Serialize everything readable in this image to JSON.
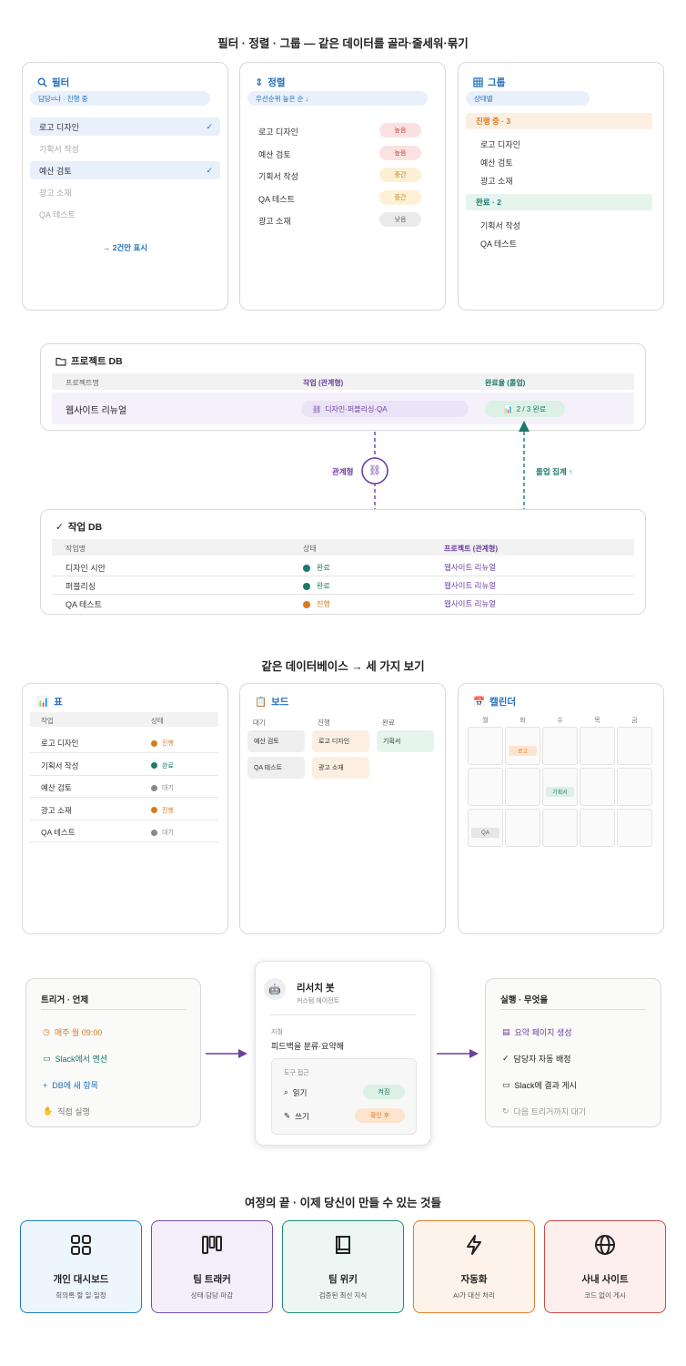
{
  "section1": {
    "title": "필터 · 정렬 · 그룹 — 같은 데이터를 골라·줄세워·묶기",
    "filter": {
      "title": "필터",
      "condition": "담당=나 · 진행 중",
      "items": [
        {
          "label": "로고 디자인",
          "matched": true
        },
        {
          "label": "기획서 작성",
          "matched": false
        },
        {
          "label": "예산 검토",
          "matched": true
        },
        {
          "label": "광고 소재",
          "matched": false
        },
        {
          "label": "QA 테스트",
          "matched": false
        }
      ],
      "check": "✓",
      "result": "→ 2건만 표시"
    },
    "sort": {
      "title": "정렬",
      "condition": "우선순위 높은 순 ↓",
      "items": [
        {
          "label": "로고 디자인",
          "priority": "높음"
        },
        {
          "label": "예산 검토",
          "priority": "높음"
        },
        {
          "label": "기획서 작성",
          "priority": "중간"
        },
        {
          "label": "QA 테스트",
          "priority": "중간"
        },
        {
          "label": "광고 소재",
          "priority": "낮음"
        }
      ]
    },
    "group": {
      "title": "그룹",
      "condition": "상태별",
      "groups": [
        {
          "header": "진행 중 · 3",
          "items": [
            "로고 디자인",
            "예산 검토",
            "광고 소재"
          ]
        },
        {
          "header": "완료 · 2",
          "items": [
            "기획서 작성",
            "QA 테스트"
          ]
        }
      ]
    }
  },
  "relation": {
    "project_db": {
      "title": "프로젝트 DB",
      "columns": [
        "프로젝트명",
        "작업 (관계형)",
        "완료율 (롤업)"
      ],
      "row": {
        "name": "웹사이트 리뉴얼",
        "relation": "디자인·퍼블리싱·QA",
        "rollup": "2 / 3 완료"
      }
    },
    "link_label": "관계형",
    "rollup_label": "롤업 집계 ↑",
    "task_db": {
      "title": "작업 DB",
      "columns": [
        "작업명",
        "상태",
        "프로젝트 (관계형)"
      ],
      "rows": [
        {
          "name": "디자인 시안",
          "status": "완료",
          "project": "웹사이트 리뉴얼"
        },
        {
          "name": "퍼블리싱",
          "status": "완료",
          "project": "웹사이트 리뉴얼"
        },
        {
          "name": "QA 테스트",
          "status": "진행",
          "project": "웹사이트 리뉴얼"
        }
      ]
    }
  },
  "views": {
    "title": "같은 데이터베이스 → 세 가지 보기",
    "table": {
      "title": "표",
      "columns": [
        "작업",
        "상태"
      ],
      "rows": [
        {
          "name": "로고 디자인",
          "status": "진행"
        },
        {
          "name": "기획서 작성",
          "status": "완료"
        },
        {
          "name": "예산 검토",
          "status": "대기"
        },
        {
          "name": "광고 소재",
          "status": "진행"
        },
        {
          "name": "QA 테스트",
          "status": "대기"
        }
      ]
    },
    "board": {
      "title": "보드",
      "columns": [
        {
          "name": "대기",
          "cards": [
            "예산 검토",
            "QA 테스트"
          ]
        },
        {
          "name": "진행",
          "cards": [
            "로고 디자인",
            "광고 소재"
          ]
        },
        {
          "name": "완료",
          "cards": [
            "기획서"
          ]
        }
      ]
    },
    "calendar": {
      "title": "캘린더",
      "days": [
        "월",
        "화",
        "수",
        "목",
        "금"
      ],
      "events": [
        {
          "label": "로고",
          "week": 0,
          "day": 1
        },
        {
          "label": "기획서",
          "week": 1,
          "day": 2
        },
        {
          "label": "QA",
          "week": 2,
          "day": 0
        }
      ]
    }
  },
  "automation": {
    "trigger": {
      "title": "트리거 · 언제",
      "items": [
        "매주 월 09:00",
        "Slack에서 멘션",
        "DB에 새 항목",
        "직접 실행"
      ]
    },
    "bot": {
      "name": "리서치 봇",
      "subtitle": "커스텀 에이전트",
      "instruction_label": "지침",
      "instruction": "피드백을 분류·요약해",
      "tools_label": "도구 접근",
      "tools": [
        {
          "label": "읽기",
          "state": "켜짐"
        },
        {
          "label": "쓰기",
          "state": "확인 후"
        }
      ]
    },
    "action": {
      "title": "실행 · 무엇을",
      "items": [
        "요약 페이지 생성",
        "담당자 자동 배정",
        "Slack에 결과 게시",
        "다음 트리거까지 대기"
      ]
    }
  },
  "journey": {
    "title": "여정의 끝 · 이제 당신이 만들 수 있는 것들",
    "cards": [
      {
        "title": "개인 대시보드",
        "subtitle": "회의록·할 일·일정",
        "color": "#1d7fc0",
        "bg": "#eef6fd"
      },
      {
        "title": "팀 트래커",
        "subtitle": "상태·담당·마감",
        "color": "#7a4fa6",
        "bg": "#f4eefa"
      },
      {
        "title": "팀 위키",
        "subtitle": "검증된 최신 지식",
        "color": "#1f8a73",
        "bg": "#ecf7f3"
      },
      {
        "title": "자동화",
        "subtitle": "AI가 대신 처리",
        "color": "#d8822f",
        "bg": "#fdf3ea"
      },
      {
        "title": "사내 사이트",
        "subtitle": "코드 없이 게시",
        "color": "#c94a4a",
        "bg": "#fcefee"
      }
    ]
  },
  "colors": {
    "blue": "#1f6fbd",
    "purple": "#6b3fa0",
    "teal": "#1a7a6b",
    "orange": "#d97a1f",
    "gray": "#888888"
  }
}
